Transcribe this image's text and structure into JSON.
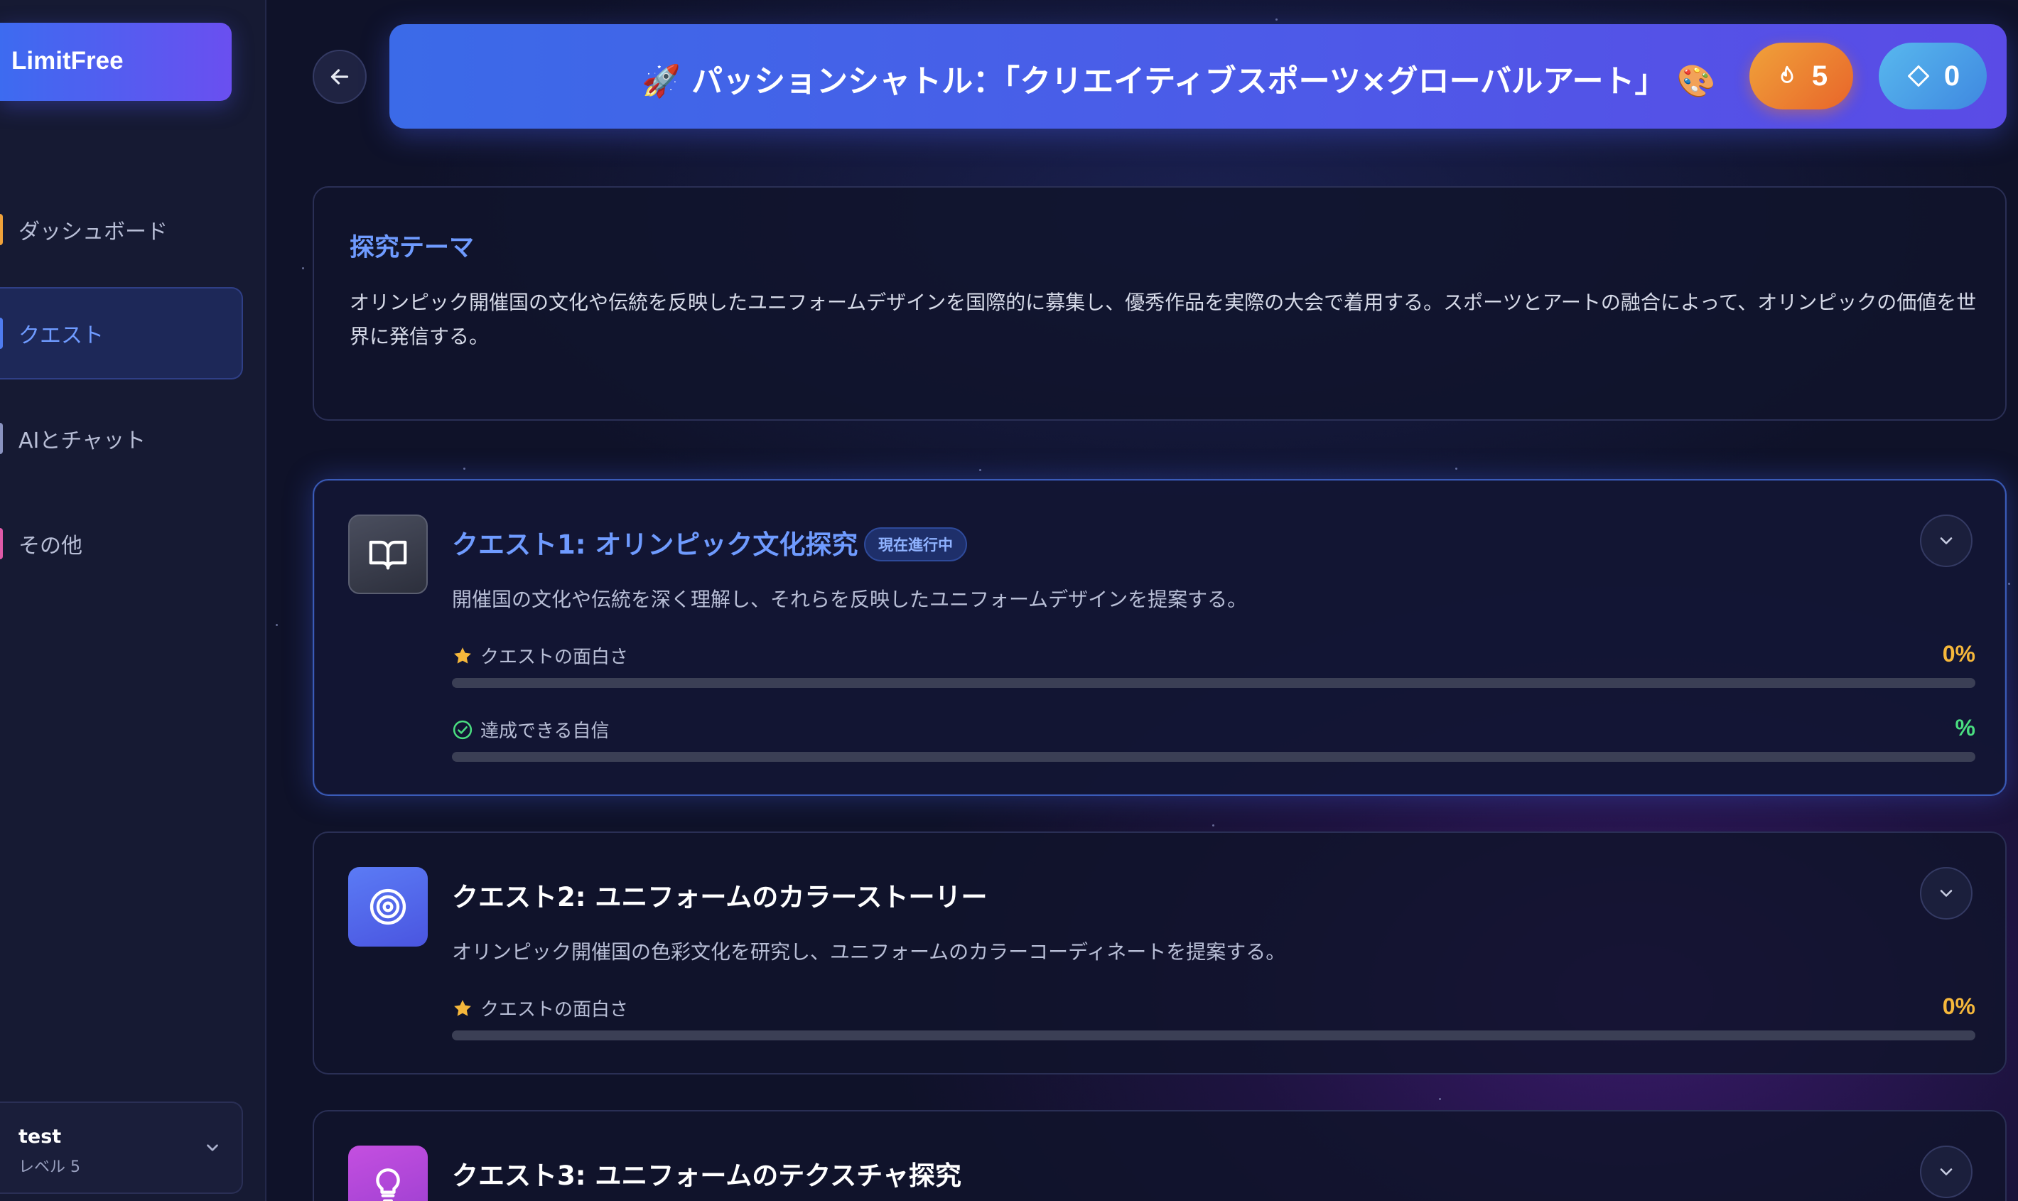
{
  "sidebar": {
    "brand": "LimitFree",
    "items": [
      {
        "label": "ダッシュボード",
        "color": "#f0a23a"
      },
      {
        "label": "クエスト",
        "color": "#4f7cf0"
      },
      {
        "label": "AIとチャット",
        "color": "#8a93c0"
      },
      {
        "label": "その他",
        "color": "#e05aa8"
      }
    ],
    "user": {
      "name": "test",
      "level": "レベル 5"
    }
  },
  "header": {
    "title": "🚀 パッションシャトル：「クリエイティブスポーツ×グローバルアート」 🎨",
    "streak": "5",
    "gems": "0",
    "streak_icon": "fire-icon",
    "gem_icon": "diamond-icon"
  },
  "theme": {
    "heading": "探究テーマ",
    "body": "オリンピック開催国の文化や伝統を反映したユニフォームデザインを国際的に募集し、優秀作品を実際の大会で着用する。スポーツとアートの融合によって、オリンピックの価値を世界に発信する。"
  },
  "quests": [
    {
      "title": "クエスト1: オリンピック文化探究",
      "badge": "現在進行中",
      "description": "開催国の文化や伝統を深く理解し、それらを反映したユニフォームデザインを提案する。",
      "icon": "book-icon",
      "metrics": [
        {
          "label": "クエストの面白さ",
          "value": "0%",
          "progress": 0,
          "icon": "star-icon",
          "color": "#f5b73b"
        },
        {
          "label": "達成できる自信",
          "value": "%",
          "progress": 0,
          "icon": "check-circle-icon",
          "color": "#4ade80"
        }
      ]
    },
    {
      "title": "クエスト2: ユニフォームのカラーストーリー",
      "description": "オリンピック開催国の色彩文化を研究し、ユニフォームのカラーコーディネートを提案する。",
      "icon": "target-icon",
      "metrics": [
        {
          "label": "クエストの面白さ",
          "value": "0%",
          "progress": 0,
          "icon": "star-icon",
          "color": "#f5b73b"
        }
      ]
    },
    {
      "title": "クエスト3: ユニフォームのテクスチャ探究",
      "icon": "lightbulb-icon"
    }
  ]
}
